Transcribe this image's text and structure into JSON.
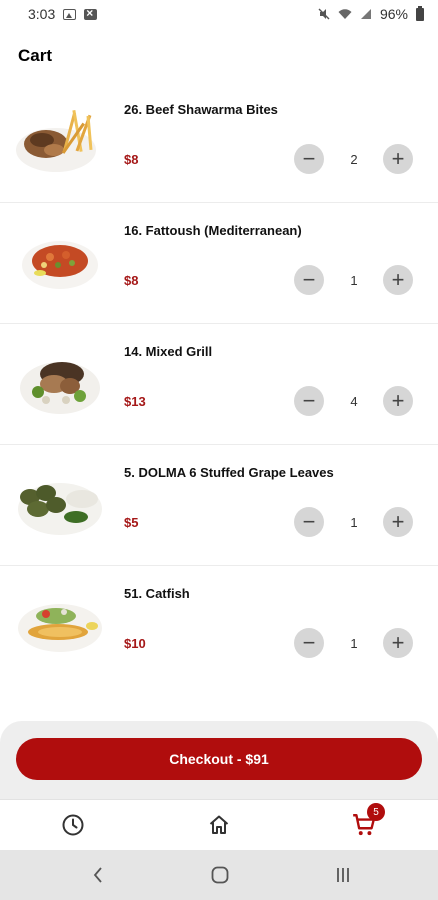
{
  "status_bar": {
    "time": "3:03",
    "battery": "96%"
  },
  "header": {
    "title": "Cart"
  },
  "cart": {
    "items": [
      {
        "name": "26. Beef Shawarma Bites",
        "price": "$8",
        "quantity": "2",
        "image": "beef-shawarma-bites-photo"
      },
      {
        "name": "16. Fattoush (Mediterranean)",
        "price": "$8",
        "quantity": "1",
        "image": "fattoush-photo"
      },
      {
        "name": "14. Mixed Grill",
        "price": "$13",
        "quantity": "4",
        "image": "mixed-grill-photo"
      },
      {
        "name": "5. DOLMA 6 Stuffed Grape Leaves",
        "price": "$5",
        "quantity": "1",
        "image": "dolma-photo"
      },
      {
        "name": "51. Catfish",
        "price": "$10",
        "quantity": "1",
        "image": "catfish-photo"
      }
    ],
    "minus_symbol": "−",
    "plus_symbol": "+"
  },
  "checkout": {
    "label": "Checkout - $91"
  },
  "bottom_nav": {
    "items": [
      {
        "icon": "clock-icon"
      },
      {
        "icon": "home-icon"
      },
      {
        "icon": "cart-icon"
      }
    ],
    "cart_badge": "5"
  },
  "colors": {
    "accent": "#b00d0d",
    "price": "#a51818"
  }
}
